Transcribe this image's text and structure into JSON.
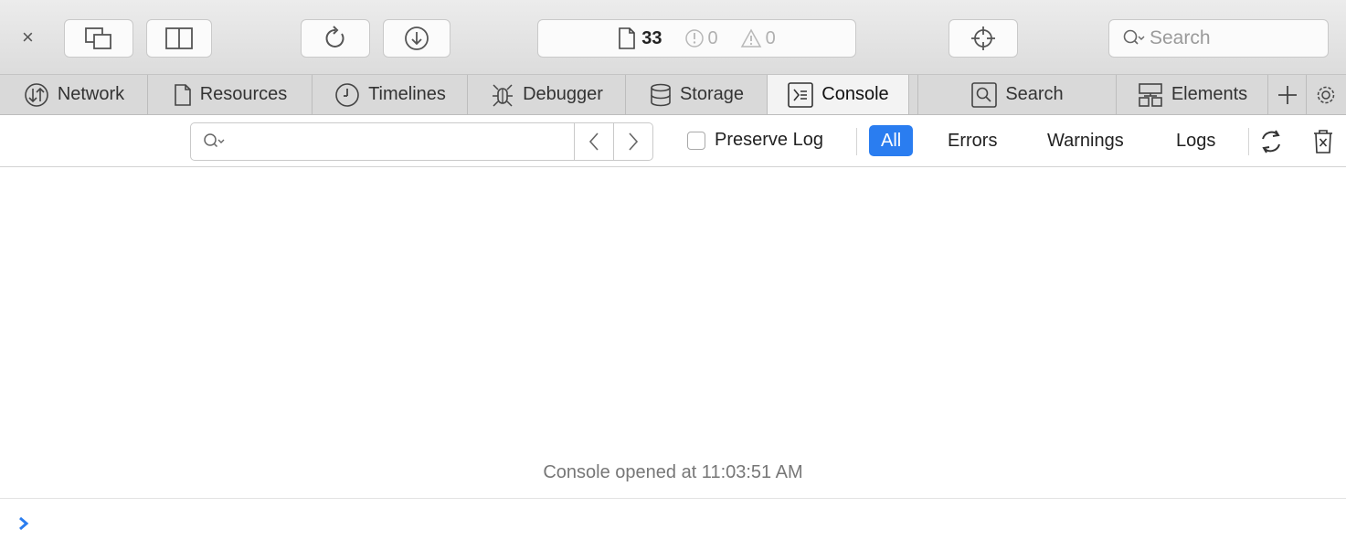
{
  "toolbar": {
    "close_glyph": "×",
    "resource_count": "33",
    "error_count": "0",
    "warning_count": "0",
    "search_placeholder": "Search"
  },
  "tabs": [
    {
      "label": "Network",
      "icon": "network-icon",
      "active": false
    },
    {
      "label": "Resources",
      "icon": "resources-icon",
      "active": false
    },
    {
      "label": "Timelines",
      "icon": "timelines-icon",
      "active": false
    },
    {
      "label": "Debugger",
      "icon": "debugger-icon",
      "active": false
    },
    {
      "label": "Storage",
      "icon": "storage-icon",
      "active": false
    },
    {
      "label": "Console",
      "icon": "console-icon",
      "active": true
    },
    {
      "label": "Search",
      "icon": "search-icon",
      "active": false
    },
    {
      "label": "Elements",
      "icon": "elements-icon",
      "active": false
    }
  ],
  "filter": {
    "preserve_log_label": "Preserve Log",
    "preserve_log_checked": false,
    "levels": [
      "All",
      "Errors",
      "Warnings",
      "Logs"
    ],
    "active_level": "All"
  },
  "console": {
    "opened_message": "Console opened at 11:03:51 AM",
    "prompt_glyph": "›"
  },
  "colors": {
    "accent": "#2a7df0",
    "toolbar_bg": "#e4e4e4",
    "tabbar_bg": "#d9d9d9"
  }
}
